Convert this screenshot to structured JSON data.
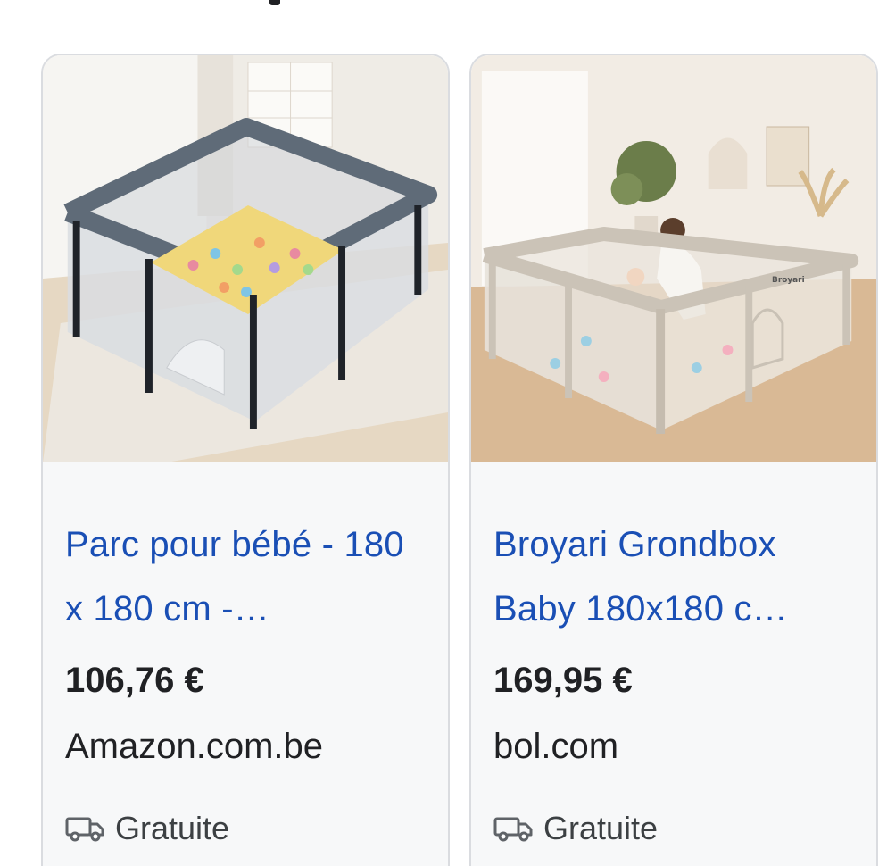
{
  "products": [
    {
      "title": "Parc pour bébé - 180 x 180 cm -…",
      "price": "106,76 €",
      "store": "Amazon.com.be",
      "shipping": "Gratuite",
      "image_icon": "gray-playpen-with-balls-image"
    },
    {
      "title": "Broyari Grondbox Baby 180x180 c…",
      "price": "169,95 €",
      "store": "bol.com",
      "shipping": "Gratuite",
      "image_icon": "beige-playpen-with-mother-and-baby-image",
      "image_brand_text": "Broyari"
    }
  ],
  "colors": {
    "title_link": "#1a4fb5",
    "card_border": "#dadce0",
    "card_bg": "#f7f8f9",
    "text": "#202124"
  }
}
